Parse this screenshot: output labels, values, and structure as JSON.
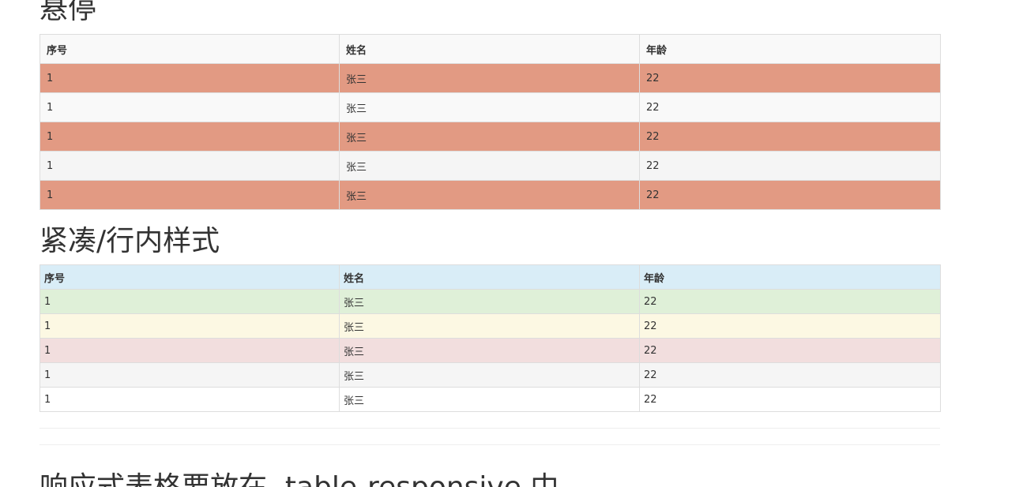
{
  "sections": {
    "hover_title": "悬停",
    "compact_title": "紧凑/行内样式",
    "responsive_title": "响应式表格要放在 .table-responsive 中"
  },
  "hover_table": {
    "headers": [
      "序号",
      "姓名",
      "年龄"
    ],
    "rows": [
      [
        "1",
        "张三",
        "22"
      ],
      [
        "1",
        "张三",
        "22"
      ],
      [
        "1",
        "张三",
        "22"
      ],
      [
        "1",
        "张三",
        "22"
      ],
      [
        "1",
        "张三",
        "22"
      ]
    ],
    "highlight_color": "#e29a83"
  },
  "compact_table": {
    "headers": [
      "序号",
      "姓名",
      "年龄"
    ],
    "rows": [
      [
        "1",
        "张三",
        "22"
      ],
      [
        "1",
        "张三",
        "22"
      ],
      [
        "1",
        "张三",
        "22"
      ],
      [
        "1",
        "张三",
        "22"
      ],
      [
        "1",
        "张三",
        "22"
      ]
    ],
    "header_style": "info",
    "row_styles": [
      "success",
      "warning",
      "danger",
      "active",
      "plain"
    ],
    "colors": {
      "info": "#d9edf7",
      "success": "#dff0d8",
      "warning": "#fcf8e3",
      "danger": "#f2dede",
      "active": "#f5f5f5"
    }
  }
}
